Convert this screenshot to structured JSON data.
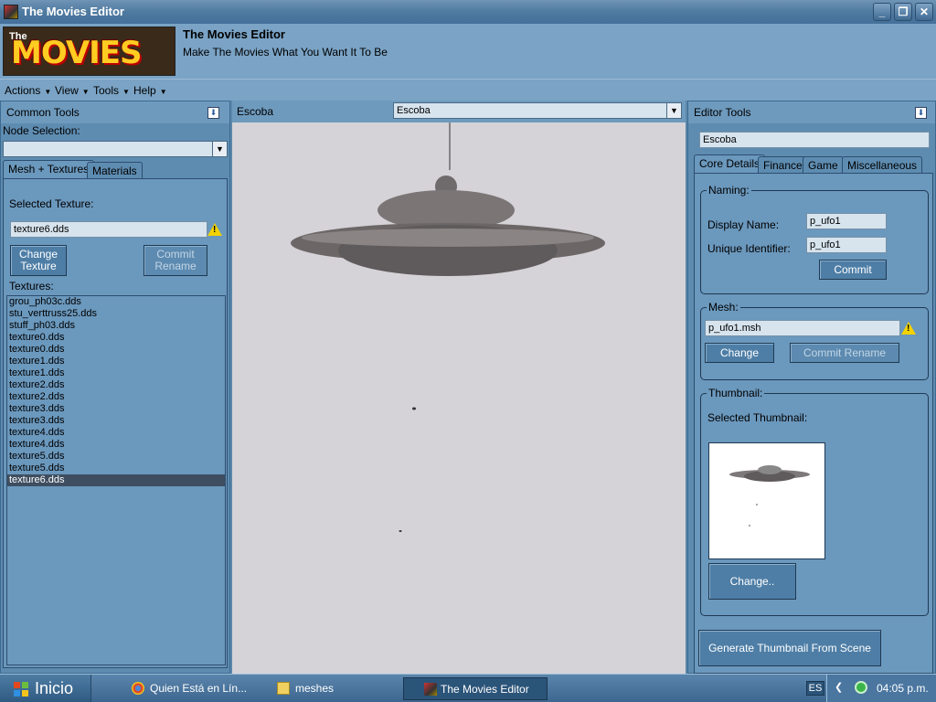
{
  "window": {
    "title": "The Movies Editor"
  },
  "header": {
    "logo_text": "MOVIES",
    "logo_the": "The",
    "app_name": "The Movies Editor",
    "tagline": "Make The Movies What You Want It To Be"
  },
  "menu": [
    {
      "label": "Actions"
    },
    {
      "label": "View"
    },
    {
      "label": "Tools"
    },
    {
      "label": "Help"
    }
  ],
  "left": {
    "title": "Common Tools",
    "node_selection_label": "Node Selection:",
    "node_selection_value": "",
    "tabs": [
      {
        "label": "Mesh + Textures"
      },
      {
        "label": "Materials"
      }
    ],
    "selected_texture_label": "Selected Texture:",
    "selected_texture_value": "texture6.dds",
    "change_texture": "Change Texture",
    "commit_rename": "Commit Rename",
    "textures_label": "Textures:",
    "textures": [
      "grou_ph03c.dds",
      "stu_verttruss25.dds",
      "stuff_ph03.dds",
      "texture0.dds",
      "texture0.dds",
      "texture1.dds",
      "texture1.dds",
      "texture2.dds",
      "texture2.dds",
      "texture3.dds",
      "texture3.dds",
      "texture4.dds",
      "texture4.dds",
      "texture5.dds",
      "texture5.dds",
      "texture6.dds"
    ],
    "selected_index": 15
  },
  "center": {
    "label": "Escoba",
    "dropdown_value": "Escoba"
  },
  "right": {
    "title": "Editor Tools",
    "object_name": "Escoba",
    "tabs": [
      {
        "label": "Core Details"
      },
      {
        "label": "Finance"
      },
      {
        "label": "Game"
      },
      {
        "label": "Miscellaneous"
      }
    ],
    "naming": {
      "title": "Naming:",
      "display_name_label": "Display Name:",
      "display_name": "p_ufo1",
      "unique_id_label": "Unique Identifier:",
      "unique_id": "p_ufo1",
      "commit": "Commit"
    },
    "mesh": {
      "title": "Mesh:",
      "value": "p_ufo1.msh",
      "change": "Change",
      "commit_rename": "Commit Rename"
    },
    "thumbnail": {
      "title": "Thumbnail:",
      "selected_label": "Selected Thumbnail:",
      "change": "Change.."
    },
    "generate": "Generate Thumbnail  From Scene"
  },
  "taskbar": {
    "start": "Inicio",
    "tasks": [
      {
        "label": "Quien Está en Lín..."
      },
      {
        "label": "meshes"
      },
      {
        "label": "The Movies Editor"
      }
    ],
    "lang": "ES",
    "time": "04:05 p.m."
  }
}
